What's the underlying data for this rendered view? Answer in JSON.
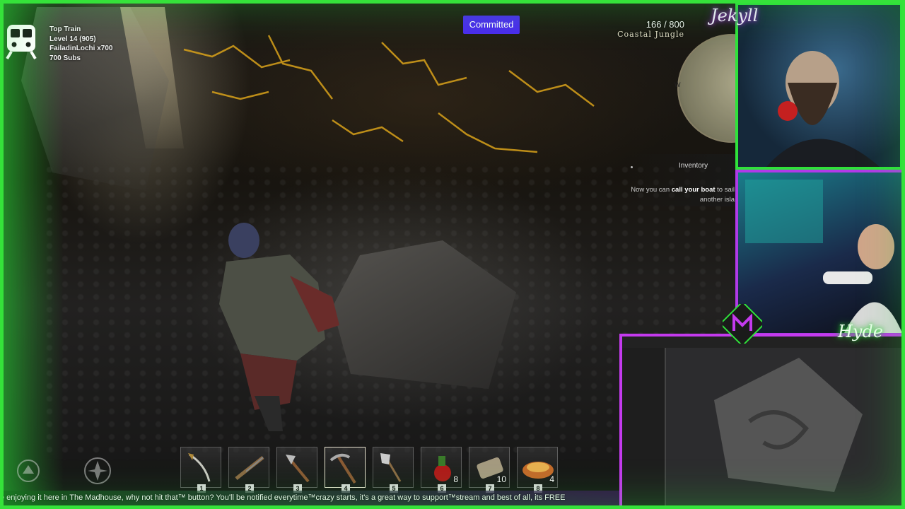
{
  "game": {
    "objective_button": "Committed",
    "counter": "166 / 800",
    "region": "Coastal Jungle",
    "minimap_letter": "W",
    "notification": {
      "title": "Inventory",
      "line1_pre": "Now you can ",
      "line1_bold": "call your boat",
      "line1_post": " to sail",
      "line2": "another isla"
    },
    "hotbar": [
      {
        "key": "1",
        "item": "saber-icon",
        "count": ""
      },
      {
        "key": "2",
        "item": "musket-icon",
        "count": ""
      },
      {
        "key": "3",
        "item": "axe-icon",
        "count": ""
      },
      {
        "key": "4",
        "item": "pickaxe-icon",
        "count": "",
        "active": true
      },
      {
        "key": "5",
        "item": "shovel-icon",
        "count": ""
      },
      {
        "key": "6",
        "item": "potion-icon",
        "count": "8"
      },
      {
        "key": "7",
        "item": "bandage-icon",
        "count": "10"
      },
      {
        "key": "8",
        "item": "food-bowl-icon",
        "count": "4"
      }
    ]
  },
  "stream": {
    "top_train": {
      "title": "Top Train",
      "level": "Level 14  (905)",
      "conductor": "FailadinLochi x700",
      "subs": "700 Subs"
    },
    "ticker": "e enjoying it here in The Madhouse, why not hit that™ button? You'll be notified everytime™crazy starts, it's a great way to support™stream and best of all, its FREE",
    "cam_jekyll_name": "Jekyll",
    "cam_hyde_name": "Hyde"
  },
  "colors": {
    "frame_green": "#35e23a",
    "frame_purple": "#c43aee",
    "committed_bg": "#4b2af0"
  }
}
